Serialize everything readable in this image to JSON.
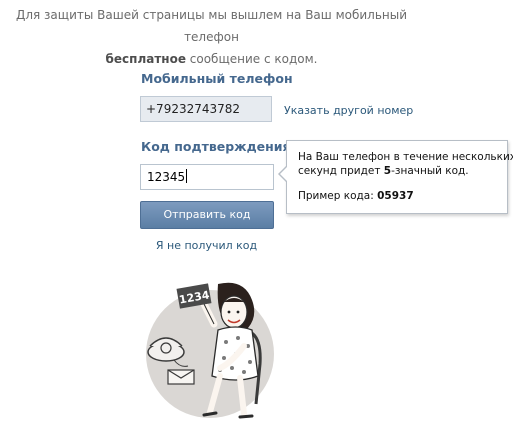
{
  "info": {
    "line1": "Для защиты Вашей страницы мы вышлем на Ваш мобильный телефон",
    "line2_bold": "бесплатное",
    "line2_rest": " сообщение с кодом."
  },
  "phone": {
    "label": "Мобильный телефон",
    "value": "+79232743782",
    "change_link": "Указать другой номер"
  },
  "code": {
    "label": "Код подтверждения",
    "value": "12345"
  },
  "tooltip": {
    "line1": "На Ваш телефон в течение нескольких",
    "line2_a": "секунд придет ",
    "line2_b": "5",
    "line2_c": "-значный код.",
    "example_label": "Пример кода: ",
    "example_value": "05937"
  },
  "submit_label": "Отправить код",
  "not_received_link": "Я не получил код",
  "illustration": {
    "sign_text": "1234"
  }
}
